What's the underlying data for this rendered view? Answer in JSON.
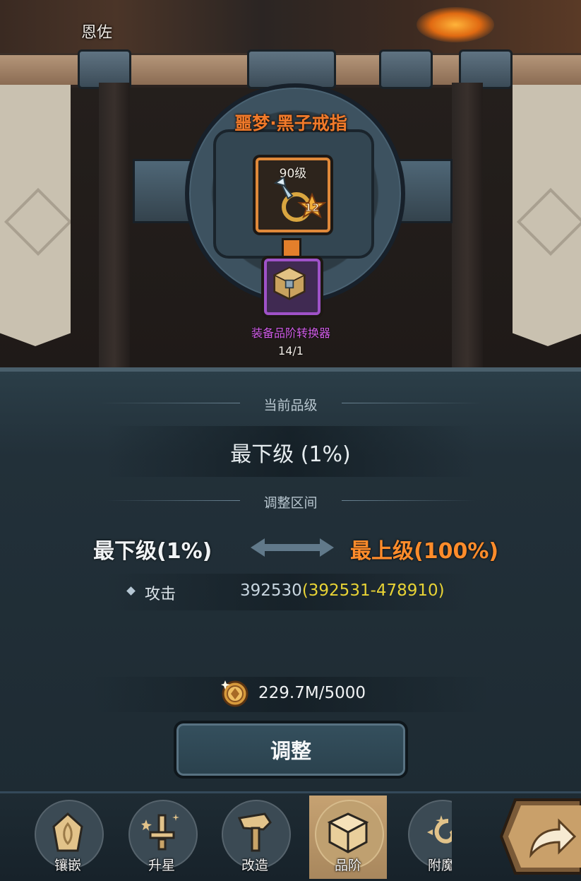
{
  "hero": {
    "name": "恩佐"
  },
  "item": {
    "title": "噩梦·黑子戒指",
    "level": "90级",
    "star_level": "12",
    "icon": "ring-icon",
    "accent_color": "#e0893a"
  },
  "consumable": {
    "name": "装备品阶转换器",
    "count": "14/1",
    "icon": "cube-icon",
    "accent_color": "#9f52c8"
  },
  "grade": {
    "current_label": "当前品级",
    "current_value": "最下级 (1%)",
    "range_label": "调整区间",
    "range_low": "最下级(1%)",
    "range_high": "最上级(100%)",
    "high_color": "#ff8c2b"
  },
  "stat": {
    "name": "攻击",
    "value": "392530",
    "range": "(392531-478910)",
    "range_color": "#e8d335"
  },
  "cost": {
    "icon": "gold-coin-icon",
    "text": "229.7M/5000"
  },
  "actions": {
    "adjust_label": "调整"
  },
  "nav": {
    "items": [
      {
        "label": "镶嵌",
        "icon": "gem-icon",
        "active": false
      },
      {
        "label": "升星",
        "icon": "sword-star-icon",
        "active": false
      },
      {
        "label": "改造",
        "icon": "hammer-icon",
        "active": false
      },
      {
        "label": "品阶",
        "icon": "cube-icon",
        "active": true
      },
      {
        "label": "附魔",
        "icon": "enchant-icon",
        "active": false
      }
    ],
    "forward_icon": "forward-arrow-icon"
  }
}
